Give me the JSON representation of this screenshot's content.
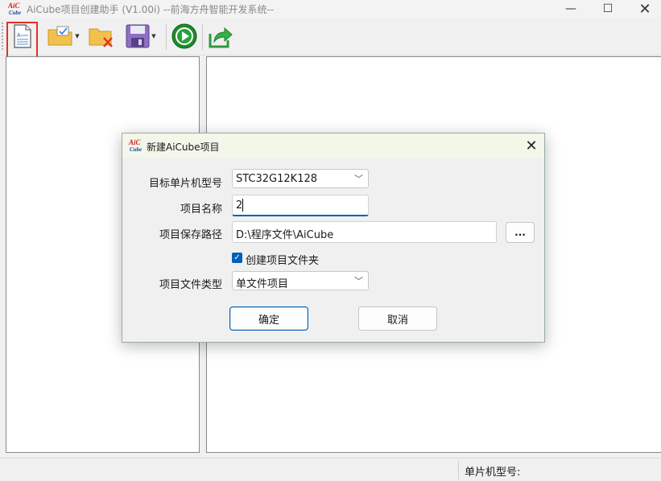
{
  "window": {
    "title": "AiCube项目创建助手 (V1.00i) --前海方舟智能开发系统--",
    "logo_top": "AiC",
    "logo_bottom": "Cube",
    "minimize_glyph": "—",
    "maximize_glyph": "☐",
    "close_glyph": "✕"
  },
  "toolbar": {
    "buttons": [
      {
        "icon": "new-document-icon"
      },
      {
        "icon": "open-folder-icon"
      },
      {
        "icon": "close-folder-icon"
      },
      {
        "icon": "save-disk-icon"
      },
      {
        "icon": "run-play-icon"
      },
      {
        "icon": "export-share-icon"
      }
    ],
    "accent": "#e0302a"
  },
  "statusbar": {
    "mcu_label": "单片机型号:"
  },
  "dialog": {
    "title": "新建AiCube项目",
    "logo_top": "AiC",
    "logo_bottom": "Cube",
    "close_glyph": "✕",
    "fields": {
      "mcu_label": "目标单片机型号",
      "mcu_value": "STC32G12K128",
      "name_label": "项目名称",
      "name_value": "2",
      "path_label": "项目保存路径",
      "path_value": "D:\\程序文件\\AiCube",
      "browse_label": "...",
      "create_folder_label": "创建项目文件夹",
      "create_folder_checked": true,
      "type_label": "项目文件类型",
      "type_value": "单文件项目"
    },
    "ok_label": "确定",
    "cancel_label": "取消",
    "accent": "#005fb8"
  }
}
